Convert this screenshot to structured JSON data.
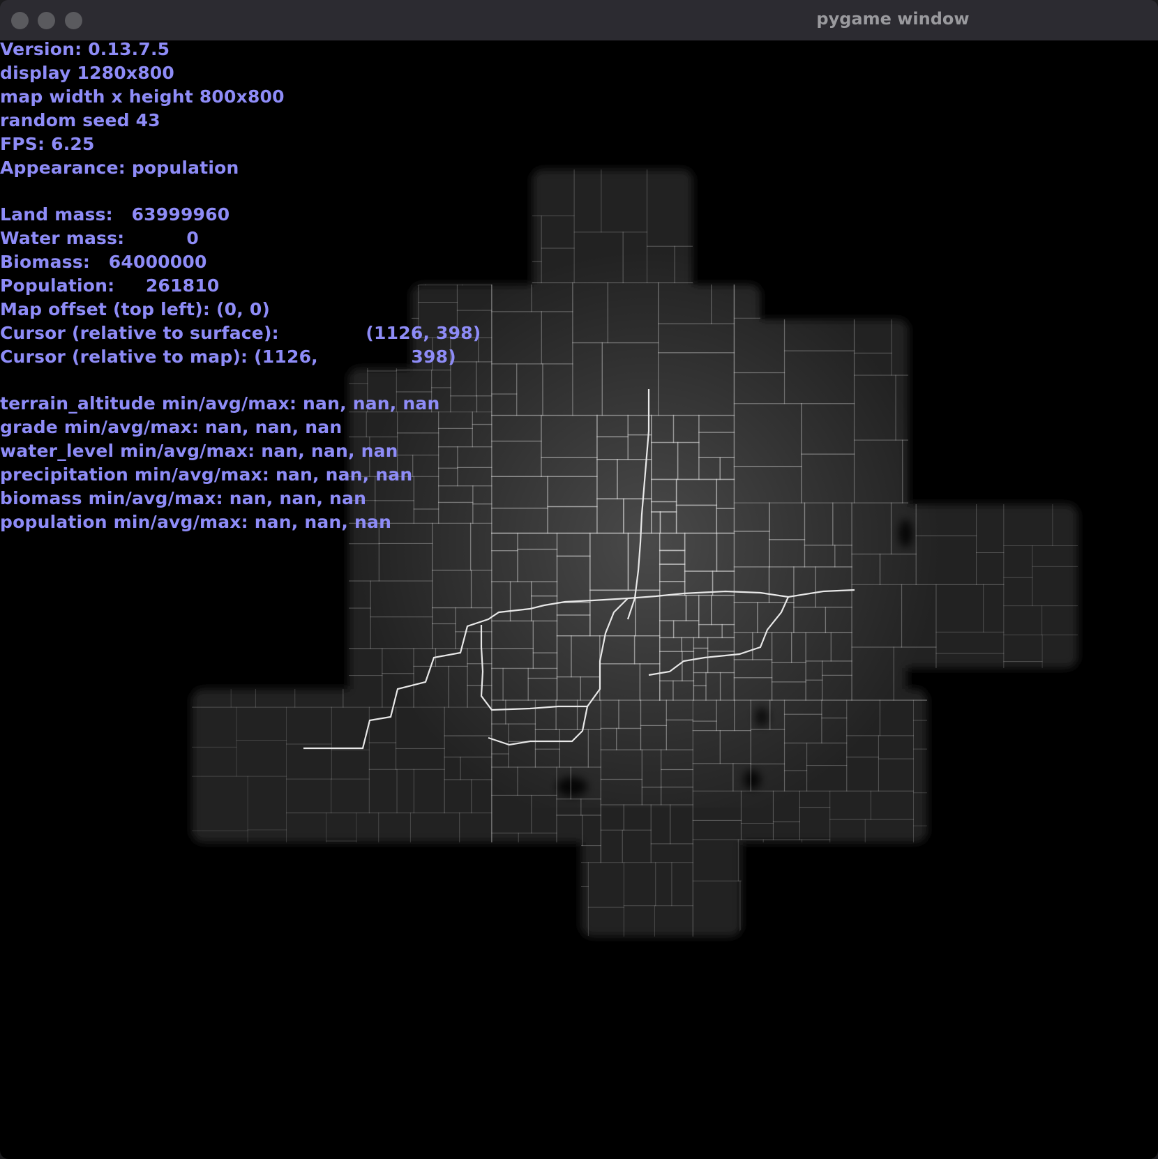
{
  "window": {
    "title": "pygame window"
  },
  "hud": {
    "version": "Version: 0.13.7.5",
    "display": "display 1280x800",
    "map_size": "map width x height 800x800",
    "seed": "random seed 43",
    "fps": "FPS: 6.25",
    "appearance": "Appearance: population",
    "land_mass": "Land mass:   63999960",
    "water_mass": "Water mass:          0",
    "biomass": "Biomass:   64000000",
    "population": "Population:     261810",
    "map_offset": "Map offset (top left): (0, 0)",
    "cursor_surface": "Cursor (relative to surface):              (1126, 398)",
    "cursor_map": "Cursor (relative to map): (1126,               398)",
    "terrain_altitude": "terrain_altitude min/avg/max: nan, nan, nan",
    "grade": "grade min/avg/max: nan, nan, nan",
    "water_level": "water_level min/avg/max: nan, nan, nan",
    "precipitation": "precipitation min/avg/max: nan, nan, nan",
    "biomass_stats": "biomass min/avg/max: nan, nan, nan",
    "population_stats": "population min/avg/max: nan, nan, nan"
  },
  "colors": {
    "hud_text": "#8e8cf7",
    "titlebar": "#2c2b31",
    "background": "#000000",
    "map_fill": "#242424",
    "road": "#cfcfcf"
  }
}
